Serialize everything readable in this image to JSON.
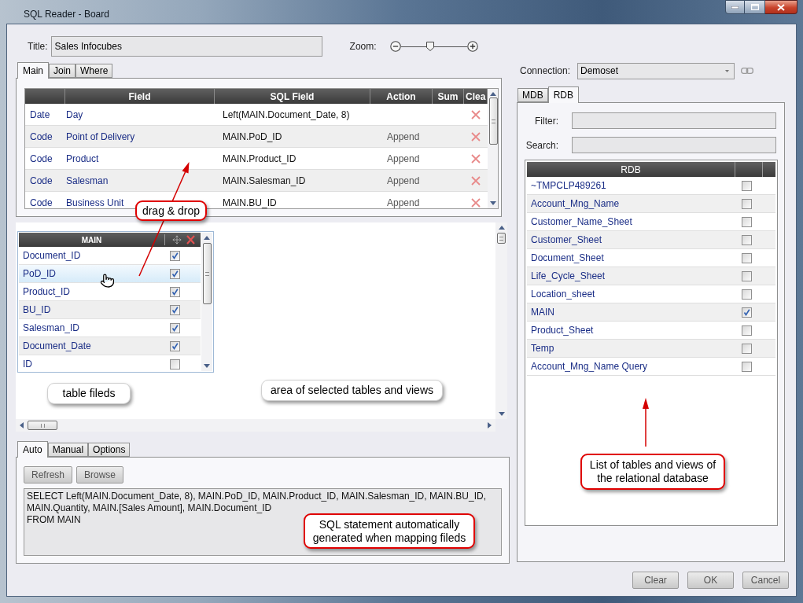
{
  "window": {
    "title": "SQL Reader - Board"
  },
  "title_field": {
    "label": "Title:",
    "value": "Sales Infocubes"
  },
  "zoom": {
    "label": "Zoom:",
    "level": 0.45
  },
  "query_tabs": [
    {
      "label": "Main",
      "selected": true
    },
    {
      "label": "Join",
      "selected": false
    },
    {
      "label": "Where",
      "selected": false
    }
  ],
  "field_grid": {
    "columns": [
      "Field",
      "SQL Field",
      "Action",
      "Sum",
      "Clea"
    ],
    "rows": [
      {
        "type": "Date",
        "field": "Day",
        "sql_field": "Left(MAIN.Document_Date, 8)"
      },
      {
        "type": "Code",
        "field": "Point of Delivery",
        "sql_field": "MAIN.PoD_ID",
        "action": "Append"
      },
      {
        "type": "Code",
        "field": "Product",
        "sql_field": "MAIN.Product_ID",
        "action": "Append"
      },
      {
        "type": "Code",
        "field": "Salesman",
        "sql_field": "MAIN.Salesman_ID",
        "action": "Append"
      },
      {
        "type": "Code",
        "field": "Business Unit",
        "sql_field": "MAIN.BU_ID",
        "action": "Append"
      }
    ]
  },
  "table_widget": {
    "title": "MAIN",
    "fields": [
      {
        "name": "Document_ID",
        "checked": true,
        "selected": false
      },
      {
        "name": "PoD_ID",
        "checked": true,
        "selected": true
      },
      {
        "name": "Product_ID",
        "checked": true,
        "selected": false
      },
      {
        "name": "BU_ID",
        "checked": true,
        "selected": false
      },
      {
        "name": "Salesman_ID",
        "checked": true,
        "selected": false
      },
      {
        "name": "Document_Date",
        "checked": true,
        "selected": false
      },
      {
        "name": "ID",
        "checked": false,
        "selected": false
      }
    ]
  },
  "sql_tabs": [
    {
      "label": "Auto",
      "selected": true
    },
    {
      "label": "Manual",
      "selected": false
    },
    {
      "label": "Options",
      "selected": false
    }
  ],
  "sql_buttons": [
    {
      "label": "Refresh"
    },
    {
      "label": "Browse"
    }
  ],
  "sql_statement": "SELECT Left(MAIN.Document_Date, 8), MAIN.PoD_ID, MAIN.Product_ID, MAIN.Salesman_ID, MAIN.BU_ID, MAIN.Quantity, MAIN.[Sales Amount], MAIN.Document_ID\nFROM MAIN",
  "connection": {
    "label": "Connection:",
    "value": "Demoset"
  },
  "source_tabs": [
    {
      "label": "MDB",
      "selected": false
    },
    {
      "label": "RDB",
      "selected": true
    }
  ],
  "filter": {
    "label": "Filter:"
  },
  "search": {
    "label": "Search:"
  },
  "rdb_grid": {
    "heading": "RDB",
    "rows": [
      {
        "name": "~TMPCLP489261",
        "checked": false
      },
      {
        "name": "Account_Mng_Name",
        "checked": false
      },
      {
        "name": "Customer_Name_Sheet",
        "checked": false
      },
      {
        "name": "Customer_Sheet",
        "checked": false
      },
      {
        "name": "Document_Sheet",
        "checked": false
      },
      {
        "name": "Life_Cycle_Sheet",
        "checked": false
      },
      {
        "name": "Location_sheet",
        "checked": false
      },
      {
        "name": "MAIN",
        "checked": true
      },
      {
        "name": "Product_Sheet",
        "checked": false
      },
      {
        "name": "Temp",
        "checked": false
      },
      {
        "name": "Account_Mng_Name Query",
        "checked": false
      }
    ]
  },
  "dialog_buttons": [
    {
      "label": "Clear"
    },
    {
      "label": "OK"
    },
    {
      "label": "Cancel"
    }
  ],
  "annotations": [
    {
      "text": "drag & drop",
      "outlined": true,
      "arrow": true
    },
    {
      "text": "table fileds",
      "outlined": false
    },
    {
      "text": "area of selected tables and views",
      "outlined": false
    },
    {
      "text": "SQL statement automatically generated when mapping fileds",
      "outlined": true
    },
    {
      "text": "List of tables and views of the relational database",
      "outlined": true,
      "arrow": true
    }
  ]
}
